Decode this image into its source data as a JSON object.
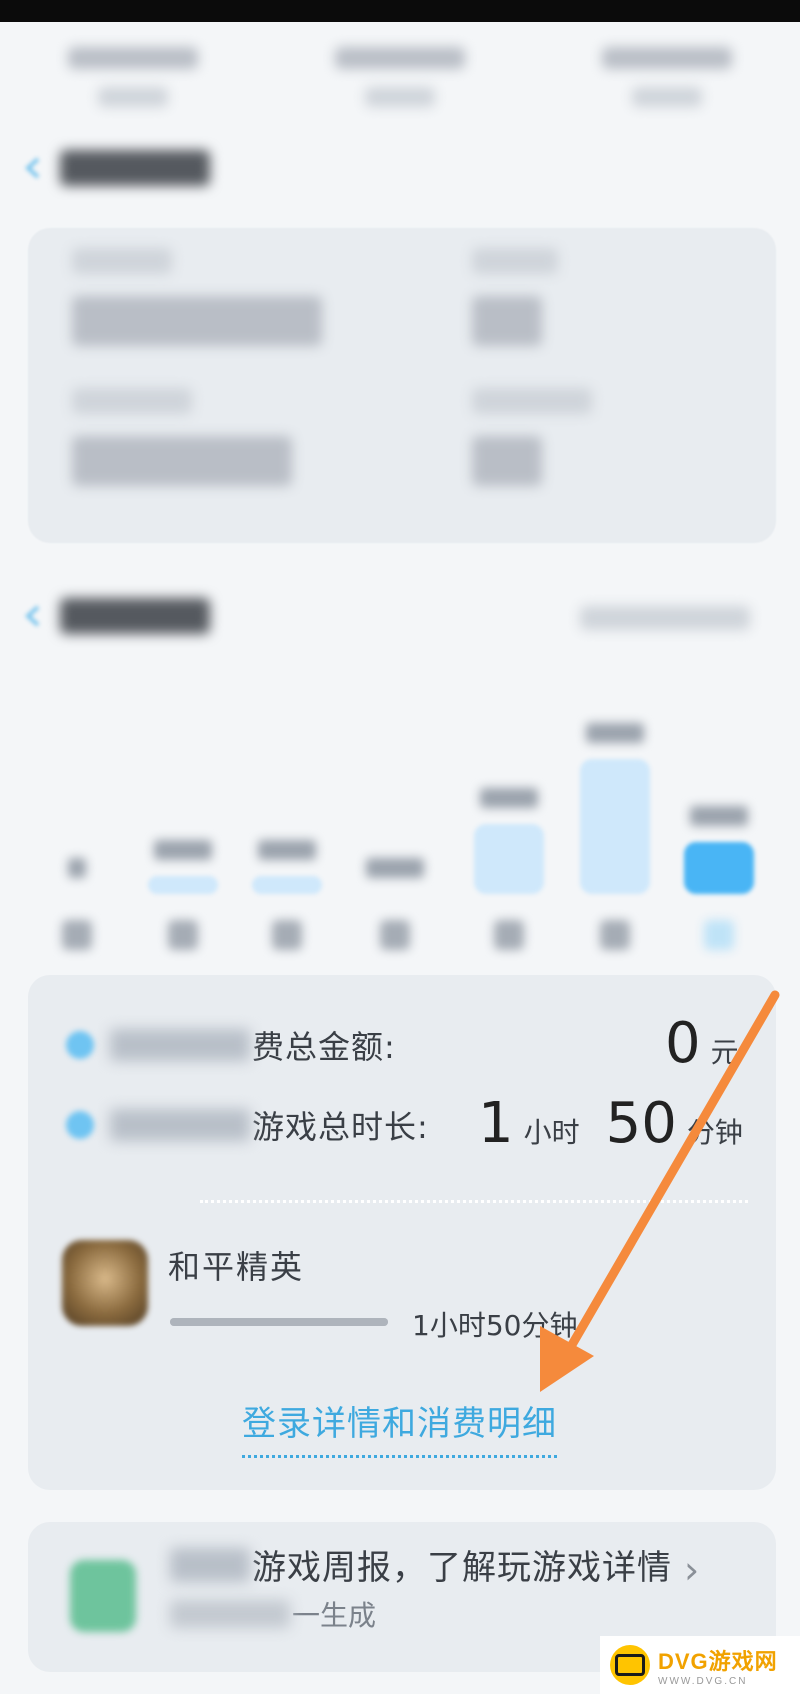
{
  "summary": {
    "spend_label_suffix": "费总金额:",
    "spend_value": "0",
    "spend_unit": "元",
    "playtime_label_suffix": "游戏总时长:",
    "playtime_hours": "1",
    "hours_unit": "小时",
    "playtime_minutes": "50",
    "minutes_unit": "分钟"
  },
  "game": {
    "name": "和平精英",
    "time": "1小时50分钟",
    "progress": 1.0
  },
  "detail_link": "登录详情和消费明细",
  "weekly": {
    "title_suffix": "游戏周报，了解玩游戏详情",
    "subtitle_suffix": "一生成",
    "chevron": "›"
  },
  "watermark": {
    "main": "DVG游戏网",
    "sub": "WWW.DVG.CN"
  },
  "colors": {
    "accent": "#3ea9df",
    "today_bar": "#49b5f5",
    "arrow": "#f58a3c"
  }
}
